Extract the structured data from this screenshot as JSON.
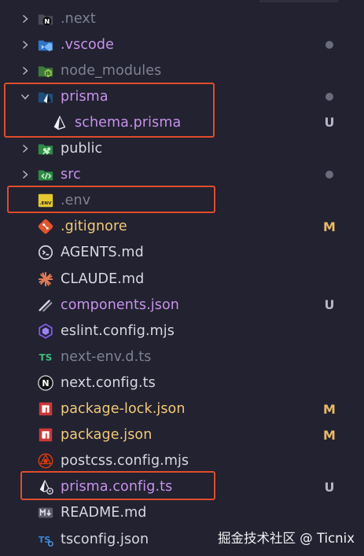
{
  "colors": {
    "background": "#222230",
    "text_default": "#d8d8e2",
    "text_dim": "#7f8094",
    "text_git_new": "#c792ea",
    "text_git_modified": "#f2c97a",
    "status_new": "#b5b5c8",
    "status_modified": "#e8b96a",
    "highlight_box": "#e04c2b"
  },
  "explorer": {
    "items": [
      {
        "label": ".next",
        "type": "folder",
        "icon": "nextjs-folder-icon",
        "tone": "dim",
        "expanded": false
      },
      {
        "label": ".vscode",
        "type": "folder",
        "icon": "vscode-folder-icon",
        "tone": "git_new",
        "dot": true,
        "expanded": false
      },
      {
        "label": "node_modules",
        "type": "folder",
        "icon": "node-folder-icon",
        "tone": "dim",
        "expanded": false
      },
      {
        "label": "prisma",
        "type": "folder",
        "icon": "prisma-folder-icon",
        "tone": "git_new",
        "dot": true,
        "expanded": true
      },
      {
        "label": "schema.prisma",
        "type": "file",
        "icon": "prisma-icon",
        "tone": "git_new",
        "status": "U",
        "depth": 1
      },
      {
        "label": "public",
        "type": "folder",
        "icon": "public-folder-icon",
        "tone": "default",
        "expanded": false
      },
      {
        "label": "src",
        "type": "folder",
        "icon": "src-folder-icon",
        "tone": "git_new",
        "dot": true,
        "expanded": false
      },
      {
        "label": ".env",
        "type": "file",
        "icon": "env-icon",
        "tone": "dim"
      },
      {
        "label": ".gitignore",
        "type": "file",
        "icon": "git-icon",
        "tone": "git_modified",
        "status": "M"
      },
      {
        "label": "AGENTS.md",
        "type": "file",
        "icon": "agents-icon",
        "tone": "default"
      },
      {
        "label": "CLAUDE.md",
        "type": "file",
        "icon": "claude-icon",
        "tone": "default"
      },
      {
        "label": "components.json",
        "type": "file",
        "icon": "json-icon",
        "tone": "git_new",
        "status": "U"
      },
      {
        "label": "eslint.config.mjs",
        "type": "file",
        "icon": "eslint-icon",
        "tone": "default"
      },
      {
        "label": "next-env.d.ts",
        "type": "file",
        "icon": "typescript-def-icon",
        "tone": "dim"
      },
      {
        "label": "next.config.ts",
        "type": "file",
        "icon": "nextjs-icon",
        "tone": "default"
      },
      {
        "label": "package-lock.json",
        "type": "file",
        "icon": "npm-icon",
        "tone": "git_modified",
        "status": "M"
      },
      {
        "label": "package.json",
        "type": "file",
        "icon": "npm-icon",
        "tone": "git_modified",
        "status": "M"
      },
      {
        "label": "postcss.config.mjs",
        "type": "file",
        "icon": "postcss-icon",
        "tone": "default"
      },
      {
        "label": "prisma.config.ts",
        "type": "file",
        "icon": "prisma-config-icon",
        "tone": "git_new",
        "status": "U"
      },
      {
        "label": "README.md",
        "type": "file",
        "icon": "markdown-icon",
        "tone": "default"
      },
      {
        "label": "tsconfig.json",
        "type": "file",
        "icon": "tsconfig-icon",
        "tone": "default"
      }
    ]
  },
  "watermark": "掘金技术社区 @ Ticnix"
}
